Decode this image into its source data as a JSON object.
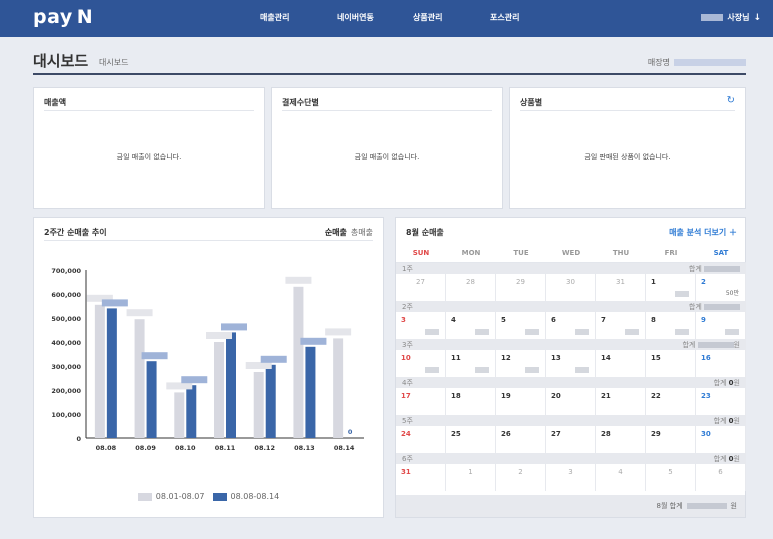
{
  "app": {
    "logo_text": "pay",
    "logo_mark": "N"
  },
  "nav": {
    "items": [
      "매출관리",
      "네이버연동",
      "상품관리",
      "포스관리"
    ],
    "user_label": "사장님",
    "user_arrow": "↓"
  },
  "page": {
    "title": "대시보드",
    "breadcrumb": "대시보드",
    "store_label": "매장명"
  },
  "cards": {
    "sales": {
      "title": "매출액",
      "empty": "금일 매출이 없습니다."
    },
    "payment": {
      "title": "결제수단별",
      "empty": "금일 매출이 없습니다."
    },
    "product": {
      "title": "상품별",
      "empty": "금일 판매된 상품이 없습니다.",
      "refresh_icon": "↻"
    }
  },
  "trend": {
    "title": "2주간 순매출 추이",
    "toggle_net": "순매출",
    "toggle_gross": "총매출",
    "legend_prev": "08.01-08.07",
    "legend_curr": "08.08-08.14",
    "zero_label": "0"
  },
  "chart_data": {
    "type": "bar",
    "categories": [
      "08.08",
      "08.09",
      "08.10",
      "08.11",
      "08.12",
      "08.13",
      "08.14"
    ],
    "series": [
      {
        "name": "08.01-08.07",
        "color": "#d7d8e0",
        "values": [
          555000,
          495000,
          190000,
          400000,
          275000,
          630000,
          415000
        ]
      },
      {
        "name": "08.08-08.14",
        "color": "#3a66a8",
        "values": [
          540000,
          320000,
          220000,
          440000,
          305000,
          380000,
          0
        ]
      }
    ],
    "yticks": [
      "0",
      "100,000",
      "200,000",
      "300,000",
      "400,000",
      "500,000",
      "600,000",
      "700,000"
    ],
    "ylim": [
      0,
      700000
    ]
  },
  "calendar": {
    "title": "8월 순매출",
    "more_label": "매출 분석 더보기 ＋",
    "dow": [
      "SUN",
      "MON",
      "TUE",
      "WED",
      "THU",
      "FRI",
      "SAT"
    ],
    "weeks": [
      {
        "label": "1주",
        "total_prefix": "합계",
        "total": "",
        "days": [
          "27",
          "28",
          "29",
          "30",
          "31",
          "1",
          "2"
        ],
        "other": [
          true,
          true,
          true,
          true,
          true,
          false,
          false
        ],
        "amt_sat": "50만"
      },
      {
        "label": "2주",
        "total_prefix": "합계",
        "total": "",
        "days": [
          "3",
          "4",
          "5",
          "6",
          "7",
          "8",
          "9"
        ],
        "other": [
          false,
          false,
          false,
          false,
          false,
          false,
          false
        ]
      },
      {
        "label": "3주",
        "total_prefix": "합계",
        "total": "원",
        "days": [
          "10",
          "11",
          "12",
          "13",
          "14",
          "15",
          "16"
        ],
        "other": [
          false,
          false,
          false,
          false,
          false,
          false,
          false
        ]
      },
      {
        "label": "4주",
        "total_prefix": "합계",
        "total": "0원",
        "days": [
          "17",
          "18",
          "19",
          "20",
          "21",
          "22",
          "23"
        ],
        "other": [
          false,
          false,
          false,
          false,
          false,
          false,
          false
        ]
      },
      {
        "label": "5주",
        "total_prefix": "합계",
        "total": "0원",
        "days": [
          "24",
          "25",
          "26",
          "27",
          "28",
          "29",
          "30"
        ],
        "other": [
          false,
          false,
          false,
          false,
          false,
          false,
          false
        ]
      },
      {
        "label": "6주",
        "total_prefix": "합계",
        "total": "0원",
        "days": [
          "31",
          "1",
          "2",
          "3",
          "4",
          "5",
          "6"
        ],
        "other": [
          false,
          true,
          true,
          true,
          true,
          true,
          true
        ]
      }
    ],
    "month_total_label": "8월 합계",
    "month_total_unit": "원"
  }
}
